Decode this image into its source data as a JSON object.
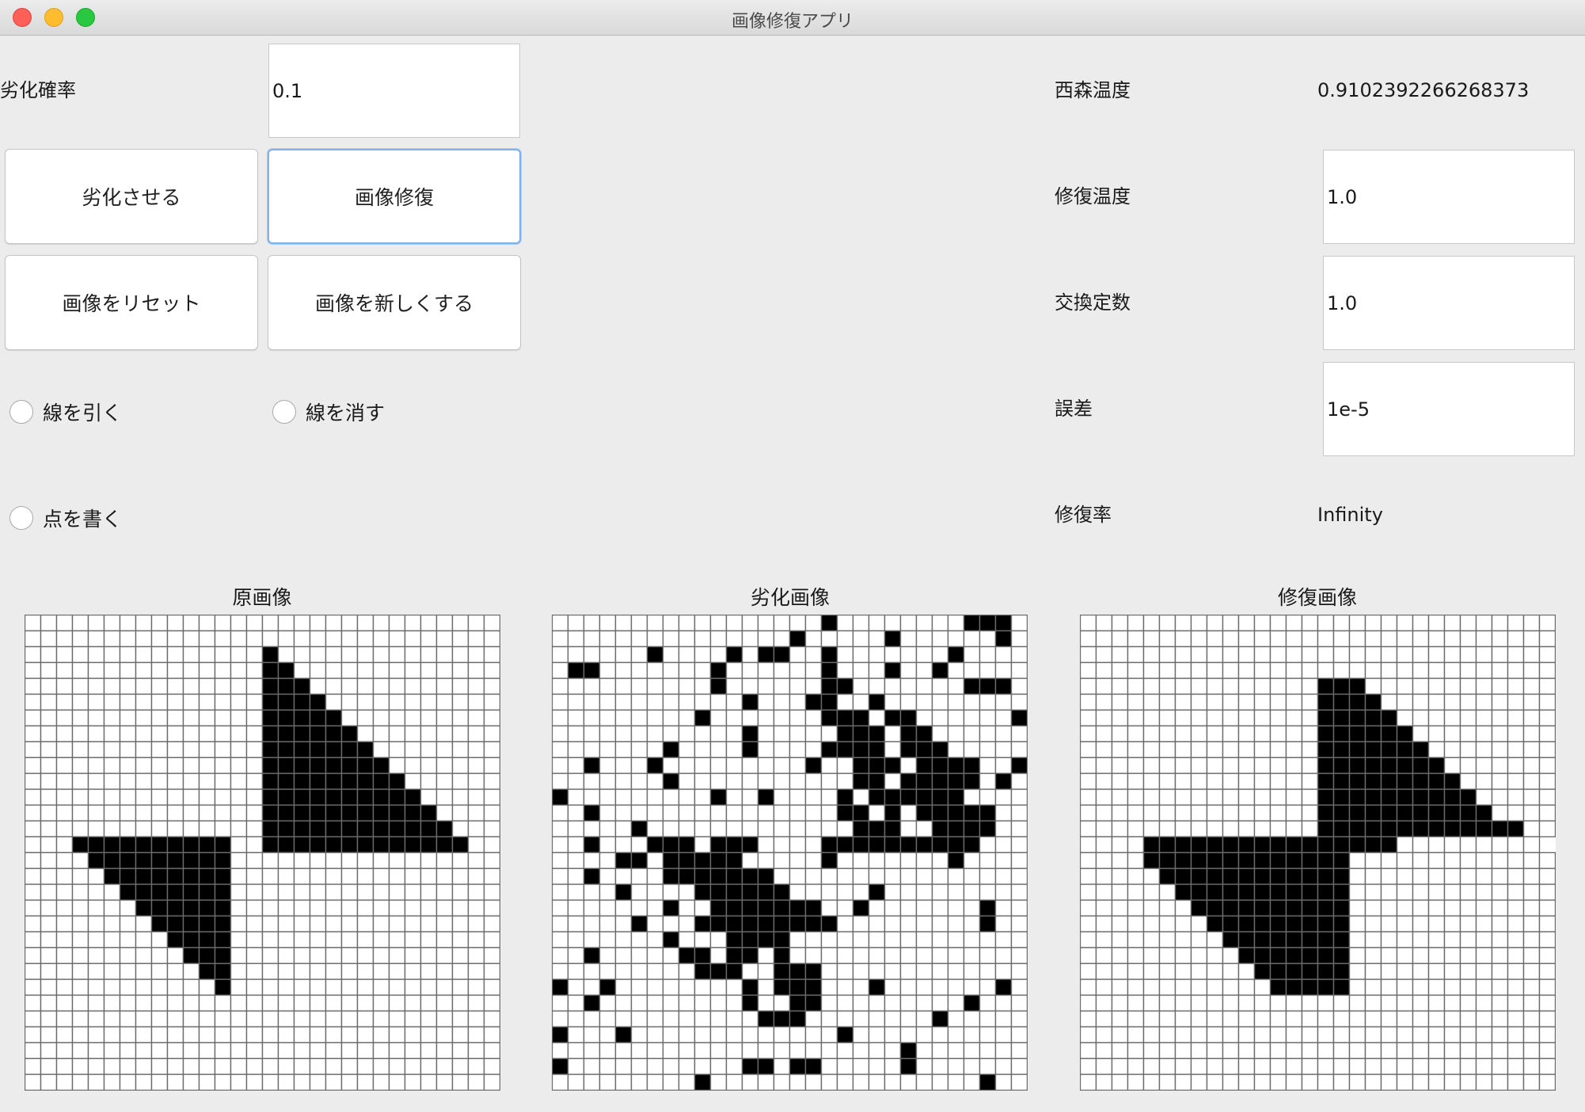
{
  "window": {
    "title": "画像修復アプリ"
  },
  "controls": {
    "degrade_prob_label": "劣化確率",
    "degrade_prob_value": "0.1",
    "buttons": {
      "degrade": "劣化させる",
      "restore": "画像修復",
      "reset": "画像をリセット",
      "new_image": "画像を新しくする"
    },
    "radios": {
      "draw_line": "線を引く",
      "erase_line": "線を消す",
      "draw_point": "点を書く"
    }
  },
  "params": {
    "nishimori_temp_label": "西森温度",
    "nishimori_temp_value": "0.9102392266268373",
    "restore_temp_label": "修復温度",
    "restore_temp_value": "1.0",
    "exchange_const_label": "交換定数",
    "exchange_const_value": "1.0",
    "error_label": "誤差",
    "error_value": "1e-5",
    "restore_rate_label": "修復率",
    "restore_rate_value": "Infinity"
  },
  "panels": {
    "original": {
      "title": "原画像",
      "rows": [
        "..............................",
        "..............................",
        "...............#..............",
        "...............##.............",
        "...............###............",
        "...............####...........",
        "...............#####..........",
        "...............######.........",
        "...............#######........",
        "...............########.......",
        "...............#########......",
        "...............##########.....",
        "...............###########....",
        "...............############...",
        "...##########..#############..",
        "....#########.................",
        ".....########.................",
        "......#######.................",
        ".......######.................",
        "........#####.................",
        ".........####.................",
        "..........###.................",
        "...........##.................",
        "............#.................",
        "..............................",
        "..............................",
        "..............................",
        "..............................",
        "..............................",
        ".............................."
      ]
    },
    "degraded": {
      "title": "劣化画像",
      "rows": [
        ".................#........###.",
        "...............#.....#......#.",
        "......#....#.##..#.......#....",
        ".##.......#......#...#..#.....",
        "..........#......##.......###.",
        "............#...##..#.........",
        ".........#.......###.##......#",
        "............#.....###.##......",
        ".......#....#....####.###.....",
        "..#...#.........#..###.####..#",
        ".......#...........##.#####.#.",
        "#.........#..#....#.######....",
        "..#...............##.#.#####..",
        ".....#.............###..####..",
        "..#...###.###....##########...",
        "....##.#####.....#.......#....",
        "..#....#######................",
        "....#....######.....#.........",
        ".......#..#######..#.......#..",
        ".....#...#########.........#..",
        ".......#...####...............",
        "..#.....##.##.#...............",
        ".........###..###.............",
        "#..#........#.###...#.......#.",
        "..#.........#..##.........#...",
        ".............###........#.....",
        "#...#.............#...........",
        "......................#.......",
        "#...........##.##.....#.......",
        ".........#.................#.."
      ]
    },
    "restored": {
      "title": "修復画像",
      "rows": [
        "..............................",
        "..............................",
        "..............................",
        "..............................",
        "...............###............",
        "...............####...........",
        "...............#####..........",
        "...............######.........",
        "...............#######........",
        "...............########.......",
        "...............#########......",
        "...............##########.....",
        "...............###########....",
        "...............#############..",
        "....################.........",
        "....#############.............",
        ".....############.............",
        "......###########.............",
        ".......##########.............",
        "........#########.............",
        ".........########.............",
        "..........#######.............",
        "...........######.............",
        "............#####.............",
        "..............................",
        "..............................",
        "..............................",
        "..............................",
        "..............................",
        ".............................."
      ]
    }
  }
}
